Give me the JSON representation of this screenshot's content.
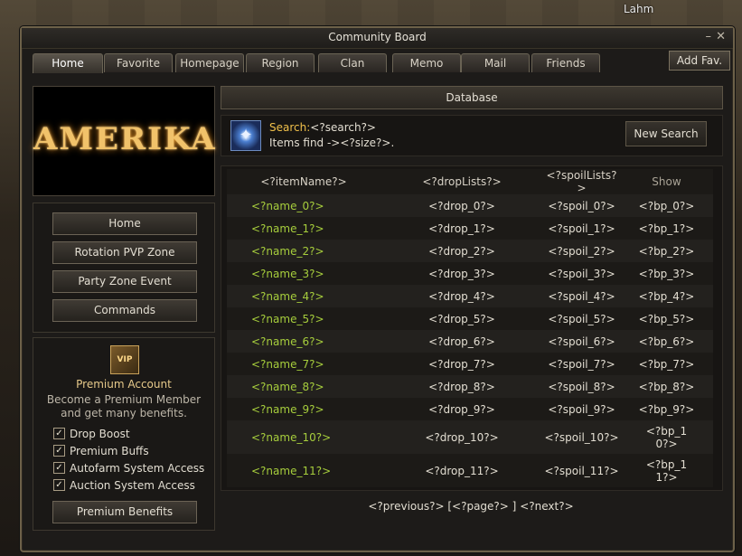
{
  "window": {
    "title": "Community Board",
    "player_name": "Lahm",
    "min_icon": "minimize-icon",
    "close_icon": "close-icon"
  },
  "tabs": [
    "Home",
    "Favorite",
    "Homepage",
    "Region",
    "Clan",
    "Memo",
    "Mail",
    "Friends"
  ],
  "add_fav_label": "Add Fav.",
  "logo": "AMERIKA",
  "menu": [
    "Home",
    "Rotation PVP Zone",
    "Party Zone Event",
    "Commands"
  ],
  "premium": {
    "icon": "vip-icon",
    "icon_text": "VIP",
    "title": "Premium Account",
    "description": "Become a Premium Member and get many benefits.",
    "features": [
      "Drop Boost",
      "Premium Buffs",
      "Autofarm System Access",
      "Auction System Access"
    ],
    "button": "Premium Benefits"
  },
  "database": {
    "header": "Database",
    "search_icon": "search-crystal-icon",
    "search_label": "Search:",
    "search_value": "<?search?>",
    "items_find": "Items find -><?size?>.",
    "new_search": "New Search",
    "columns": [
      "<?itemName?>",
      "<?dropLists?>",
      "<?spoilLists?>",
      "Show"
    ],
    "rows": [
      {
        "name": "<?name_0?>",
        "drop": "<?drop_0?>",
        "spoil": "<?spoil_0?>",
        "bp": "<?bp_0?>"
      },
      {
        "name": "<?name_1?>",
        "drop": "<?drop_1?>",
        "spoil": "<?spoil_1?>",
        "bp": "<?bp_1?>"
      },
      {
        "name": "<?name_2?>",
        "drop": "<?drop_2?>",
        "spoil": "<?spoil_2?>",
        "bp": "<?bp_2?>"
      },
      {
        "name": "<?name_3?>",
        "drop": "<?drop_3?>",
        "spoil": "<?spoil_3?>",
        "bp": "<?bp_3?>"
      },
      {
        "name": "<?name_4?>",
        "drop": "<?drop_4?>",
        "spoil": "<?spoil_4?>",
        "bp": "<?bp_4?>"
      },
      {
        "name": "<?name_5?>",
        "drop": "<?drop_5?>",
        "spoil": "<?spoil_5?>",
        "bp": "<?bp_5?>"
      },
      {
        "name": "<?name_6?>",
        "drop": "<?drop_6?>",
        "spoil": "<?spoil_6?>",
        "bp": "<?bp_6?>"
      },
      {
        "name": "<?name_7?>",
        "drop": "<?drop_7?>",
        "spoil": "<?spoil_7?>",
        "bp": "<?bp_7?>"
      },
      {
        "name": "<?name_8?>",
        "drop": "<?drop_8?>",
        "spoil": "<?spoil_8?>",
        "bp": "<?bp_8?>"
      },
      {
        "name": "<?name_9?>",
        "drop": "<?drop_9?>",
        "spoil": "<?spoil_9?>",
        "bp": "<?bp_9?>"
      },
      {
        "name": "<?name_10?>",
        "drop": "<?drop_10?>",
        "spoil": "<?spoil_10?>",
        "bp": "<?bp_10?>"
      },
      {
        "name": "<?name_11?>",
        "drop": "<?drop_11?>",
        "spoil": "<?spoil_11?>",
        "bp": "<?bp_11?>"
      }
    ]
  },
  "pager": {
    "previous": "<?previous?>",
    "page": "[<?page?> ]",
    "next": "<?next?>"
  },
  "colors": {
    "accent_gold": "#f0c04a",
    "item_name_green": "#a6cd3c"
  }
}
